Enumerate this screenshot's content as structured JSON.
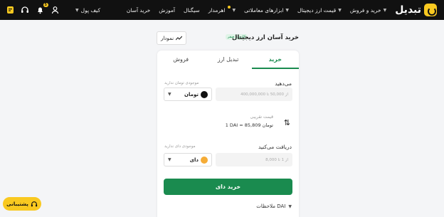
{
  "nav": {
    "brand": "تبدیل",
    "items": [
      {
        "label": "خرید و فروش",
        "dropdown": true
      },
      {
        "label": "قیمت ارز دیجیتال",
        "dropdown": true
      },
      {
        "label": "ابزارهای معاملاتی",
        "dropdown": true
      },
      {
        "label": "اهرمدار",
        "dropdown": true,
        "new": true
      },
      {
        "label": "سیگنال",
        "dropdown": false
      },
      {
        "label": "آموزش",
        "dropdown": false
      },
      {
        "label": "خرید آسان",
        "dropdown": false
      }
    ],
    "wallet": "کیف پول",
    "notifications_count": "5"
  },
  "header": {
    "title": "خرید آسان ارز دیجیتال",
    "tag": "کارمزد صفر",
    "chart_button": "نمودار"
  },
  "tabs": [
    {
      "label": "خرید",
      "active": true
    },
    {
      "label": "تبدیل ارز",
      "active": false
    },
    {
      "label": "فروش",
      "active": false
    }
  ],
  "pay": {
    "label": "می‌دهید",
    "placeholder": "از 50,000 تا 400,000,000",
    "balance_note": "موجودی تومان ندارید",
    "currency": "تومان"
  },
  "rate": {
    "label": "قیمت تقریبی",
    "value": "1 DAI = 85,809 تومان"
  },
  "receive": {
    "label": "دریافت می‌کنید",
    "placeholder": "از 1 تا 8,000",
    "balance_note": "موجودی دای ندارید",
    "currency": "دای"
  },
  "buy_button": "خرید دای",
  "notes_label": "ملاحظات DAI",
  "support_label": "پشتیبانی",
  "colors": {
    "accent": "#1a8b4f",
    "brand": "#f9c920",
    "topbar": "#111111"
  }
}
